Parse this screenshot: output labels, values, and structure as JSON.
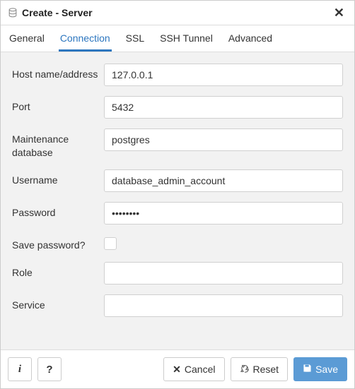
{
  "dialog": {
    "title": "Create - Server"
  },
  "tabs": {
    "general": "General",
    "connection": "Connection",
    "ssl": "SSL",
    "sshtunnel": "SSH Tunnel",
    "advanced": "Advanced"
  },
  "form": {
    "host_label": "Host name/address",
    "host_value": "127.0.0.1",
    "port_label": "Port",
    "port_value": "5432",
    "maintdb_label": "Maintenance database",
    "maintdb_value": "postgres",
    "username_label": "Username",
    "username_value": "database_admin_account",
    "password_label": "Password",
    "password_value": "••••••••",
    "savepw_label": "Save password?",
    "role_label": "Role",
    "role_value": "",
    "service_label": "Service",
    "service_value": ""
  },
  "footer": {
    "info_tooltip": "i",
    "help_tooltip": "?",
    "cancel": "Cancel",
    "reset": "Reset",
    "save": "Save"
  }
}
